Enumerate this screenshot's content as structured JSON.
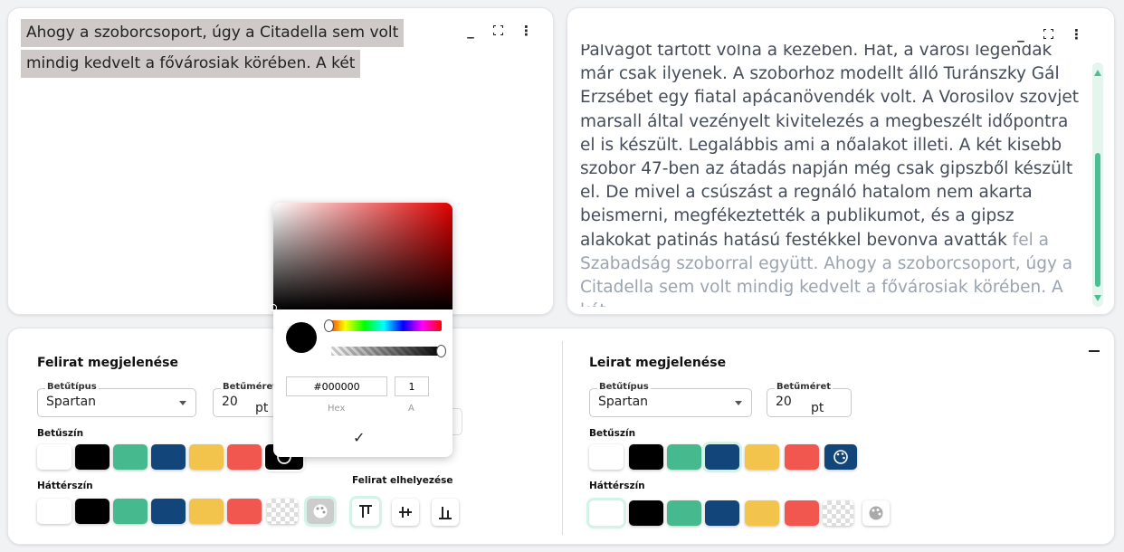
{
  "caption_preview": {
    "lines": [
      "Ahogy a szoborcsoport, úgy a Citadella sem volt",
      "mindig kedvelt a fővárosiak körében. A két"
    ]
  },
  "window_controls": {
    "minimize": "_",
    "expand": "⛶",
    "more": "⋮"
  },
  "description_preview": {
    "text_main": "Pálvágot tartott volna a kezében. Hát, a városi legendák már csak ilyenek. A szoborhoz modellt álló Turánszky Gál Erzsébet egy fiatal apácanövendék volt. A Vorosilov szovjet marsall által vezényelt kivitelezés a megbeszélt időpontra el is készült. Legalábbis ami a nőalakot illeti. A két kisebb szobor 47-ben az átadás napján még csak gipszből készült el. De mivel a csúszást a regnáló hatalom nem akarta beismerni, megfékeztették a publikumot, és a gipsz alakokat patinás hatású festékkel bevonva avatták",
    "text_faded": " fel a Szabadság szoborral együtt. Ahogy a szoborcsoport, úgy a Citadella sem volt mindig kedvelt a fővárosiak körében. A két"
  },
  "caption_settings": {
    "title": "Felirat megjelenése",
    "font_label": "Betűtípus",
    "font_value": "Spartan",
    "size_label": "Betűméret",
    "size_value": "20",
    "size_unit": "pt",
    "font_color_label": "Betűszín",
    "bg_color_label": "Háttérszín",
    "position_label": "Felirat elhelyezése"
  },
  "description_settings": {
    "title": "Leirat megjelenése",
    "font_label": "Betűtípus",
    "font_value": "Spartan",
    "size_label": "Betűméret",
    "size_value": "20",
    "size_unit": "pt",
    "font_color_label": "Betűszín",
    "bg_color_label": "Háttérszín"
  },
  "swatch_colors": [
    "#ffffff",
    "#000000",
    "#46b98f",
    "#12467a",
    "#f3c44c",
    "#f2574f"
  ],
  "color_picker": {
    "hex_value": "#000000",
    "alpha_value": "1",
    "hex_label": "Hex",
    "alpha_label": "A",
    "confirm": "✓",
    "hue_color": "#e00000"
  }
}
